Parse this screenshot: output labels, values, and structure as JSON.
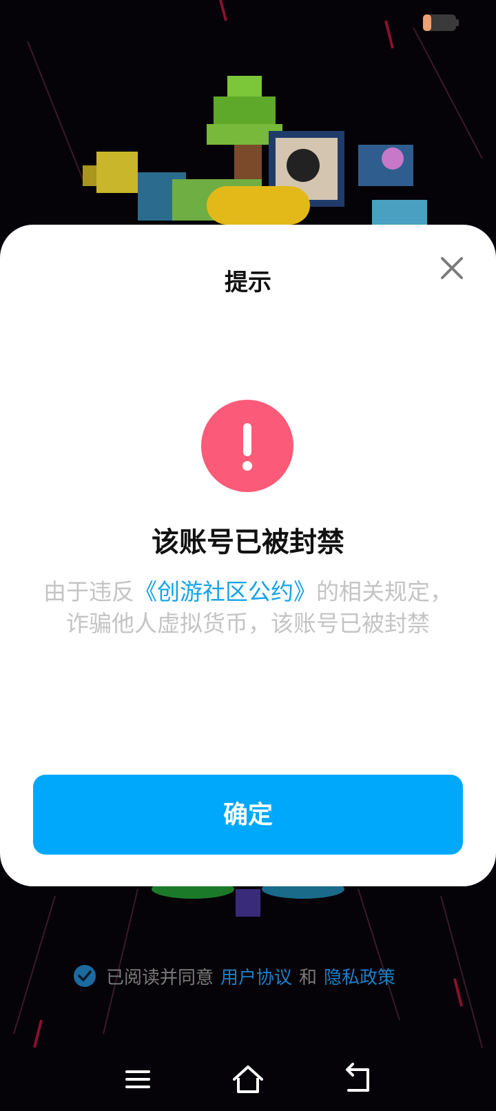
{
  "dialog": {
    "title": "提示",
    "heading": "该账号已被封禁",
    "message_before": "由于违反",
    "message_link": "《创游社区公约》",
    "message_after": "的相关规定，诈骗他人虚拟货币，该账号已被封禁",
    "confirm_label": "确定",
    "icon": "exclamation-icon"
  },
  "agreement": {
    "checked": true,
    "text_before": "已阅读并同意",
    "user_agreement_link": "用户协议",
    "conjunction": "和",
    "privacy_link": "隐私政策"
  },
  "navbar": {
    "icons": [
      "menu-icon",
      "home-icon",
      "back-icon"
    ]
  },
  "colors": {
    "accent": "#00a8fc",
    "alert": "#fb5a78",
    "link": "#14a3e8"
  }
}
